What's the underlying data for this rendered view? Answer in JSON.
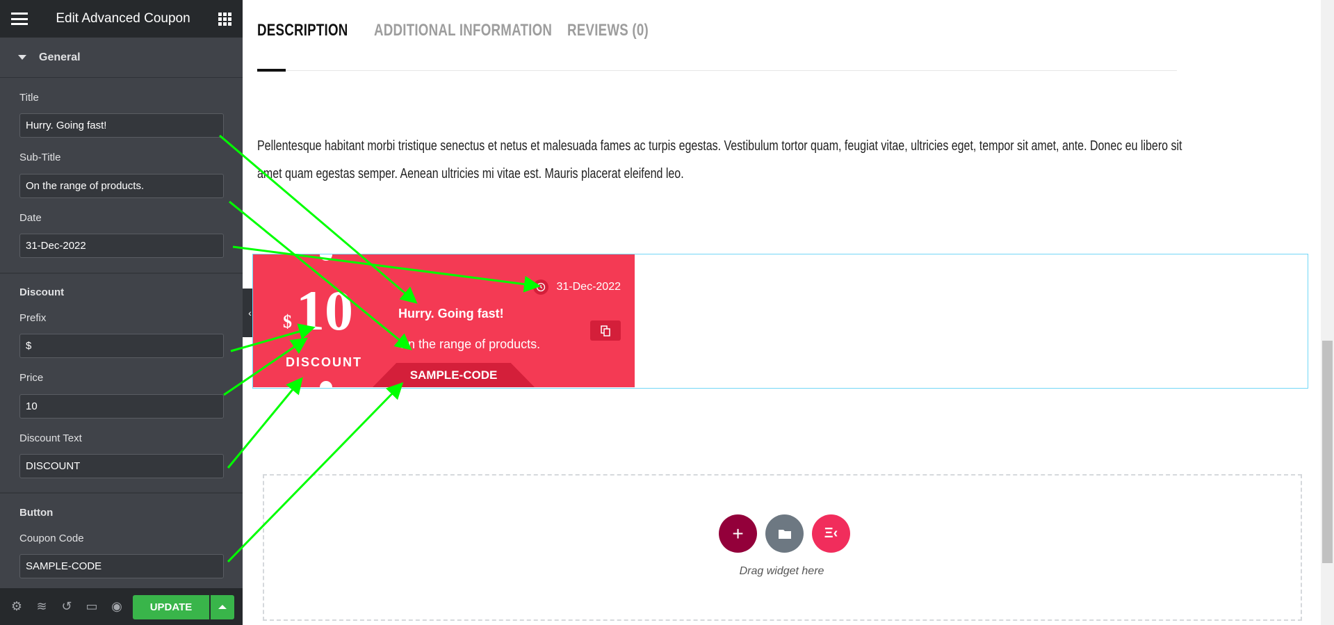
{
  "panel": {
    "title": "Edit Advanced Coupon",
    "section": "General",
    "fields": {
      "title_label": "Title",
      "title_value": "Hurry. Going fast!",
      "subtitle_label": "Sub-Title",
      "subtitle_value": "On the range of products.",
      "date_label": "Date",
      "date_value": "31-Dec-2022",
      "discount_heading": "Discount",
      "prefix_label": "Prefix",
      "prefix_value": "$",
      "price_label": "Price",
      "price_value": "10",
      "dtext_label": "Discount Text",
      "dtext_value": "DISCOUNT",
      "button_heading": "Button",
      "code_label": "Coupon Code",
      "code_value": "SAMPLE-CODE"
    },
    "update": "UPDATE"
  },
  "tabs": [
    "DESCRIPTION",
    "ADDITIONAL INFORMATION",
    "REVIEWS (0)"
  ],
  "description": "Pellentesque habitant morbi tristique senectus et netus et malesuada fames ac turpis egestas. Vestibulum tortor quam, feugiat vitae, ultricies eget, tempor sit amet, ante. Donec eu libero sit amet quam egestas semper. Aenean ultricies mi vitae est. Mauris placerat eleifend leo.",
  "coupon": {
    "prefix": "$",
    "price": "10",
    "discount_text": "DISCOUNT",
    "date": "31-Dec-2022",
    "title": "Hurry. Going fast!",
    "subtitle": "On the range of products.",
    "code": "SAMPLE-CODE",
    "color": "#f43a54"
  },
  "dropzone": {
    "text": "Drag widget here"
  }
}
